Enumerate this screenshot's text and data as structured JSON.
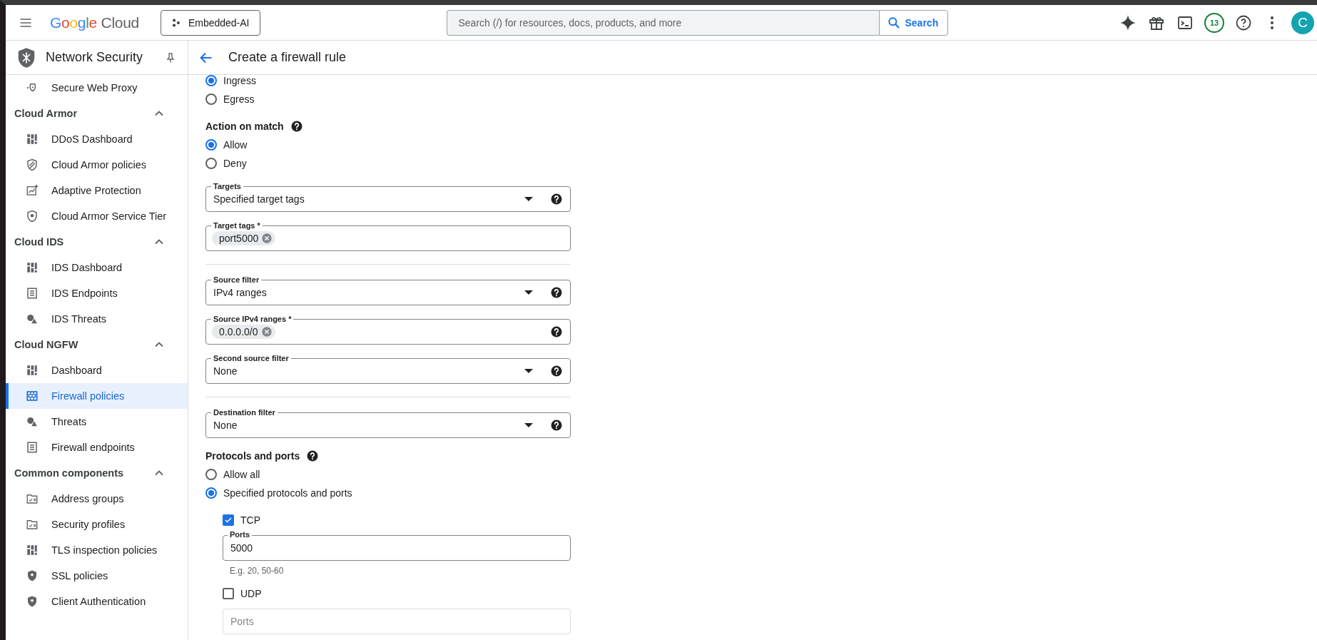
{
  "header": {
    "logo": {
      "brand": "Google",
      "product": "Cloud"
    },
    "project": "Embedded-AI",
    "search": {
      "placeholder": "Search (/) for resources, docs, products, and more",
      "button": "Search"
    },
    "notifications": "13",
    "avatar": "C"
  },
  "sidebar": {
    "title": "Network Security",
    "sections": [
      {
        "items": [
          {
            "label": "Secure Web Proxy",
            "selected": false
          }
        ]
      },
      {
        "title": "Cloud Armor",
        "expanded": true,
        "items": [
          {
            "label": "DDoS Dashboard",
            "selected": false
          },
          {
            "label": "Cloud Armor policies",
            "selected": false
          },
          {
            "label": "Adaptive Protection",
            "selected": false
          },
          {
            "label": "Cloud Armor Service Tier",
            "selected": false
          }
        ]
      },
      {
        "title": "Cloud IDS",
        "expanded": true,
        "items": [
          {
            "label": "IDS Dashboard",
            "selected": false
          },
          {
            "label": "IDS Endpoints",
            "selected": false
          },
          {
            "label": "IDS Threats",
            "selected": false
          }
        ]
      },
      {
        "title": "Cloud NGFW",
        "expanded": true,
        "items": [
          {
            "label": "Dashboard",
            "selected": false
          },
          {
            "label": "Firewall policies",
            "selected": true
          },
          {
            "label": "Threats",
            "selected": false
          },
          {
            "label": "Firewall endpoints",
            "selected": false
          }
        ]
      },
      {
        "title": "Common components",
        "expanded": true,
        "items": [
          {
            "label": "Address groups",
            "selected": false
          },
          {
            "label": "Security profiles",
            "selected": false
          },
          {
            "label": "TLS inspection policies",
            "selected": false
          },
          {
            "label": "SSL policies",
            "selected": false
          },
          {
            "label": "Client Authentication",
            "selected": false
          }
        ]
      }
    ]
  },
  "page": {
    "title": "Create a firewall rule"
  },
  "form": [
    {
      "kind": "radio",
      "label": "Ingress",
      "selected": true
    },
    {
      "kind": "radio",
      "label": "Egress",
      "selected": false
    },
    {
      "kind": "heading",
      "label": "Action on match",
      "help": true
    },
    {
      "kind": "radio",
      "label": "Allow",
      "selected": true
    },
    {
      "kind": "radio",
      "label": "Deny",
      "selected": false
    },
    {
      "kind": "select",
      "label": "Targets",
      "value": "Specified target tags",
      "help": true
    },
    {
      "kind": "chips",
      "label": "Target tags *",
      "chips": [
        "port5000"
      ],
      "help": false
    },
    {
      "kind": "divider"
    },
    {
      "kind": "select",
      "label": "Source filter",
      "value": "IPv4 ranges",
      "help": true
    },
    {
      "kind": "chips",
      "label": "Source IPv4 ranges *",
      "chips": [
        "0.0.0.0/0"
      ],
      "help": true
    },
    {
      "kind": "select",
      "label": "Second source filter",
      "value": "None",
      "help": true
    },
    {
      "kind": "divider"
    },
    {
      "kind": "select",
      "label": "Destination filter",
      "value": "None",
      "help": true
    },
    {
      "kind": "heading",
      "label": "Protocols and ports",
      "help": true
    },
    {
      "kind": "radio",
      "label": "Allow all",
      "selected": false
    },
    {
      "kind": "radio",
      "label": "Specified protocols and ports",
      "selected": true
    },
    {
      "kind": "checkbox",
      "label": "TCP",
      "checked": true
    },
    {
      "kind": "text",
      "label": "Ports",
      "value": "5000",
      "hint": "E.g. 20, 50-60",
      "disabled": false
    },
    {
      "kind": "checkbox",
      "label": "UDP",
      "checked": false
    },
    {
      "kind": "text",
      "placeholder": "Ports",
      "disabled": true
    }
  ]
}
